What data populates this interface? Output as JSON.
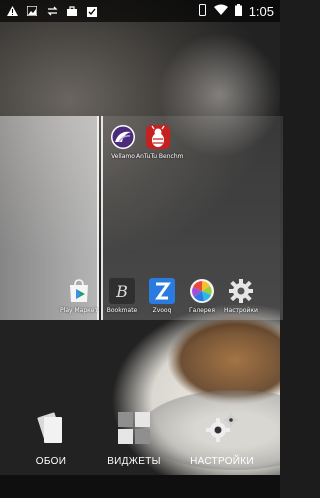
{
  "status_bar": {
    "time": "1:05",
    "left_icons": [
      "warning-icon",
      "gallery-icon",
      "sync-icon",
      "bag-icon",
      "clipboard-check-icon"
    ],
    "right_icons": [
      "vibrate-icon",
      "wifi-icon",
      "battery-icon"
    ]
  },
  "home_page": {
    "apps_top": [
      {
        "label": "Vellamo",
        "icon": "vellamo-icon",
        "color": "#4a2c7a"
      },
      {
        "label": "AnTuTu Benchm",
        "icon": "antutu-icon",
        "color": "#c62020"
      }
    ],
    "apps_dock": [
      {
        "label": "Play Маркет",
        "icon": "play-store-icon",
        "color": "#ffffff"
      },
      {
        "label": "Bookmate",
        "icon": "bookmate-icon",
        "color": "#3a3a3a"
      },
      {
        "label": "Zvooq",
        "icon": "zvooq-icon",
        "color": "#2a7be0"
      },
      {
        "label": "Галерея",
        "icon": "gallery-pinwheel-icon",
        "color": "#f4f4f4"
      },
      {
        "label": "Настройки",
        "icon": "settings-gear-icon",
        "color": "#9a9a9a"
      }
    ]
  },
  "bottom_options": [
    {
      "label": "ОБОИ",
      "icon": "wallpaper-icon"
    },
    {
      "label": "ВИДЖЕТЫ",
      "icon": "widgets-icon"
    },
    {
      "label": "НАСТРОЙКИ",
      "icon": "settings-icon"
    }
  ]
}
